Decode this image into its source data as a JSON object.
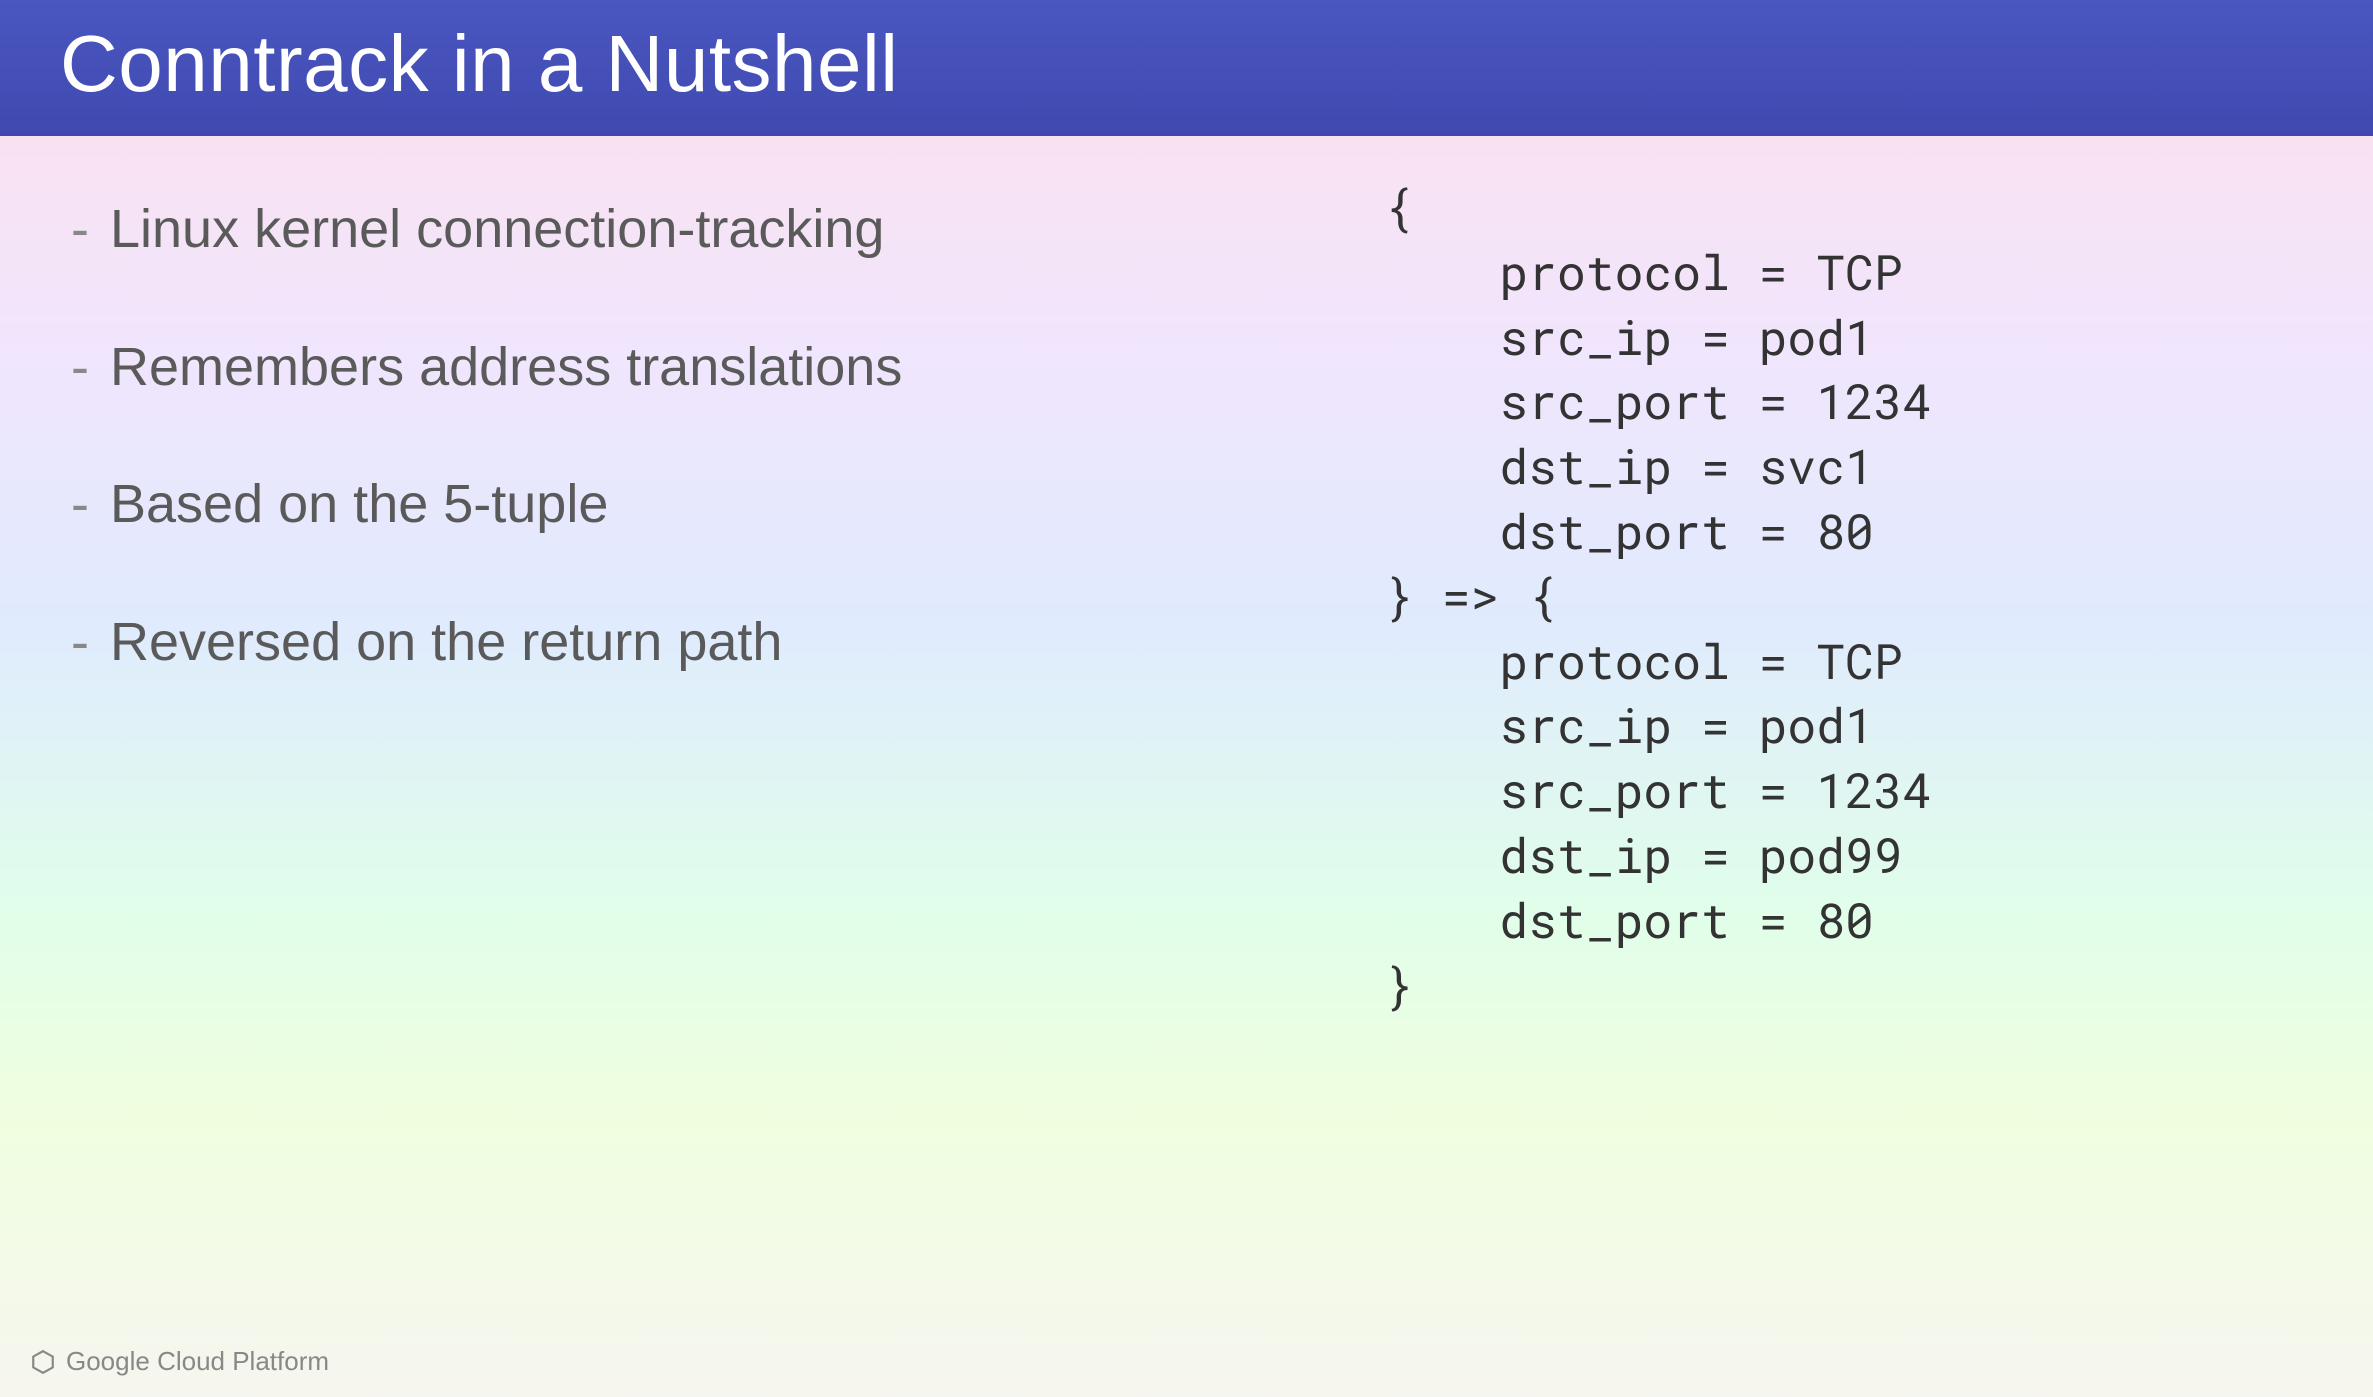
{
  "title": "Conntrack in a Nutshell",
  "bullets": [
    "Linux kernel connection-tracking",
    "Remembers address translations",
    "Based on the 5-tuple",
    "Reversed on the return path"
  ],
  "code_lines": [
    "{",
    "    protocol = TCP",
    "    src_ip = pod1",
    "    src_port = 1234",
    "    dst_ip = svc1",
    "    dst_port = 80",
    "} => {",
    "    protocol = TCP",
    "    src_ip = pod1",
    "    src_port = 1234",
    "    dst_ip = pod99",
    "    dst_port = 80",
    "}"
  ],
  "footer": "Google Cloud Platform"
}
